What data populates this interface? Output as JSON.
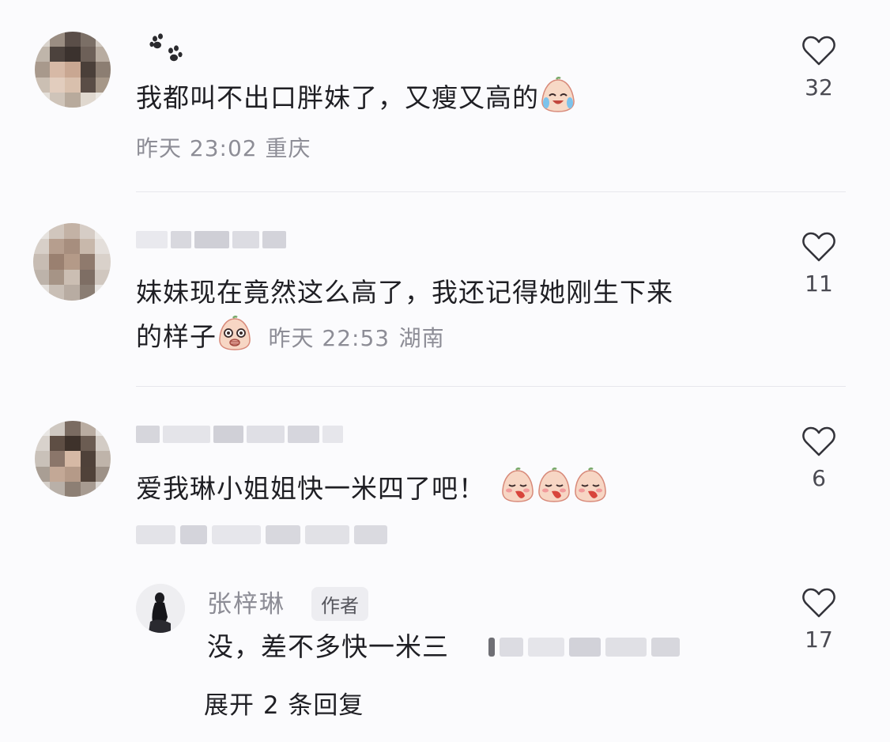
{
  "comments": [
    {
      "text": "我都叫不出口胖妹了，又瘦又高的",
      "time": "昨天 23:02",
      "location": "重庆",
      "likes": "32"
    },
    {
      "text_line1": "妹妹现在竟然这么高了，我还记得她刚生下来",
      "text_line2": "的样子",
      "time": "昨天 22:53",
      "location": "湖南",
      "likes": "11"
    },
    {
      "text": "爱我琳小姐姐快一米四了吧！",
      "likes": "6"
    }
  ],
  "reply": {
    "author": "张梓琳",
    "badge": "作者",
    "text": "没，差不多快一米三",
    "likes": "17",
    "expand_label": "展开 2 条回复"
  },
  "icons": {
    "like": "heart-outline-icon",
    "paw": "paw-print-icon",
    "emoji_crying": "crying-laughing-face-icon",
    "emoji_shocked": "shocked-face-icon",
    "emoji_shy": "shy-face-icon"
  },
  "colors": {
    "background": "#fbfbfd",
    "text": "#1f1f24",
    "meta": "#8d8d96",
    "divider": "#e7e7ec"
  }
}
